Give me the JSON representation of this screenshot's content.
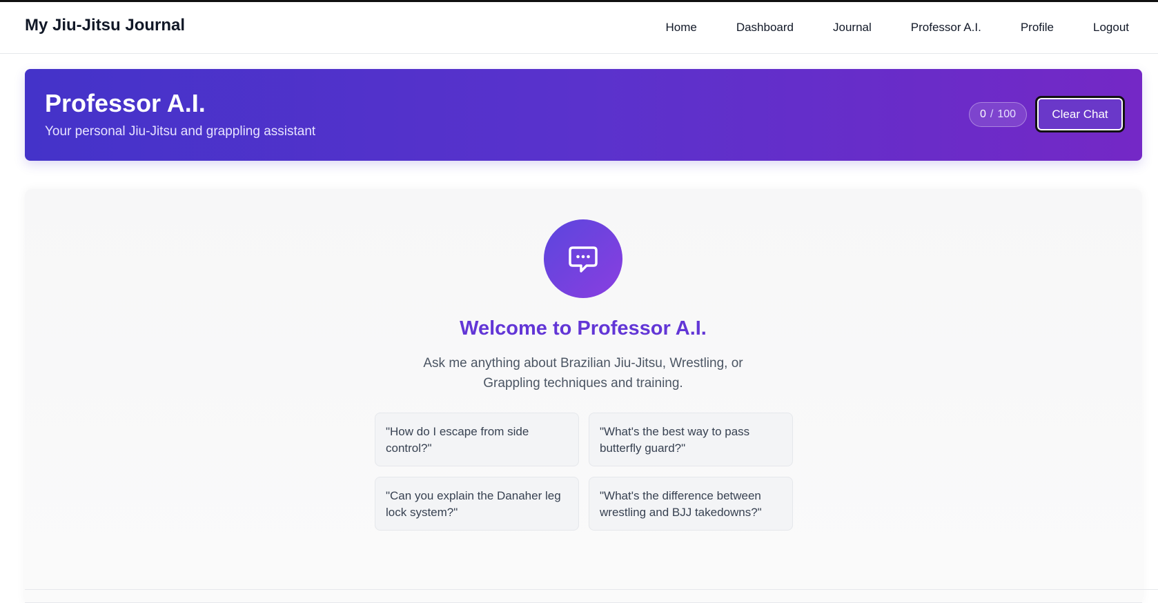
{
  "navbar": {
    "brand": "My Jiu-Jitsu Journal",
    "links": [
      "Home",
      "Dashboard",
      "Journal",
      "Professor A.I.",
      "Profile",
      "Logout"
    ]
  },
  "hero": {
    "title": "Professor A.I.",
    "subtitle": "Your personal Jiu-Jitsu and grappling assistant",
    "counter_used": "0",
    "counter_separator": "/",
    "counter_limit": "100",
    "clear_label": "Clear Chat"
  },
  "chat": {
    "icon": "chat-bubble-icon",
    "welcome_title": "Welcome to Professor A.I.",
    "welcome_text": "Ask me anything about Brazilian Jiu-Jitsu, Wrestling, or Grappling techniques and training.",
    "suggestions": [
      "\"How do I escape from side control?\"",
      "\"What's the best way to pass butterfly guard?\"",
      "\"Can you explain the Danaher leg lock system?\"",
      "\"What's the difference between wrestling and BJJ takedowns?\""
    ]
  },
  "colors": {
    "hero_gradient_start": "#4433c9",
    "hero_gradient_end": "#7428c6",
    "accent": "#6236d6"
  }
}
